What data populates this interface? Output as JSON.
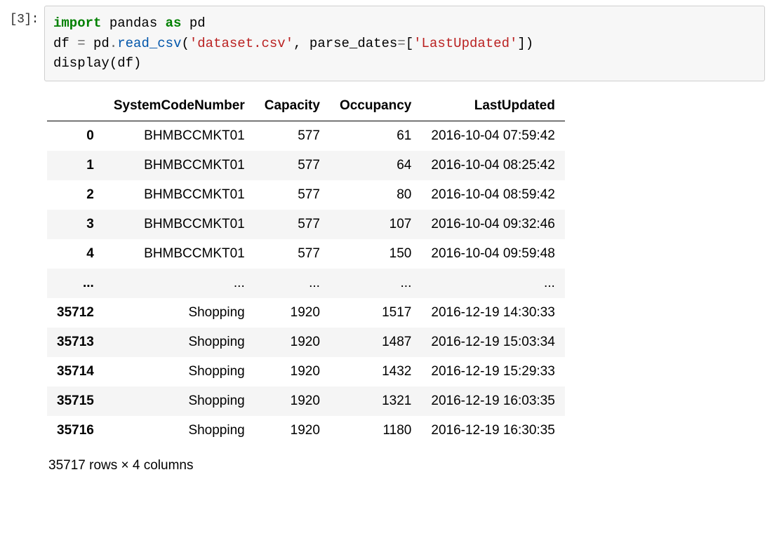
{
  "prompt": "[3]:",
  "code": {
    "kw_import": "import",
    "name_pandas": " pandas ",
    "kw_as": "as",
    "name_pd": " pd",
    "l2_a": "df ",
    "l2_op": "=",
    "l2_b": " pd",
    "l2_dot1": ".",
    "l2_call": "read_csv",
    "l2_open": "(",
    "l2_str1": "'dataset.csv'",
    "l2_comma": ", parse_dates",
    "l2_eq2": "=",
    "l2_lbr": "[",
    "l2_str2": "'LastUpdated'",
    "l2_rbr": "]",
    "l2_close": ")",
    "l3_a": "display(df)"
  },
  "table": {
    "columns": [
      "SystemCodeNumber",
      "Capacity",
      "Occupancy",
      "LastUpdated"
    ],
    "rows": [
      {
        "index": "0",
        "cells": [
          "BHMBCCMKT01",
          "577",
          "61",
          "2016-10-04 07:59:42"
        ]
      },
      {
        "index": "1",
        "cells": [
          "BHMBCCMKT01",
          "577",
          "64",
          "2016-10-04 08:25:42"
        ]
      },
      {
        "index": "2",
        "cells": [
          "BHMBCCMKT01",
          "577",
          "80",
          "2016-10-04 08:59:42"
        ]
      },
      {
        "index": "3",
        "cells": [
          "BHMBCCMKT01",
          "577",
          "107",
          "2016-10-04 09:32:46"
        ]
      },
      {
        "index": "4",
        "cells": [
          "BHMBCCMKT01",
          "577",
          "150",
          "2016-10-04 09:59:48"
        ]
      },
      {
        "index": "...",
        "cells": [
          "...",
          "...",
          "...",
          "..."
        ]
      },
      {
        "index": "35712",
        "cells": [
          "Shopping",
          "1920",
          "1517",
          "2016-12-19 14:30:33"
        ]
      },
      {
        "index": "35713",
        "cells": [
          "Shopping",
          "1920",
          "1487",
          "2016-12-19 15:03:34"
        ]
      },
      {
        "index": "35714",
        "cells": [
          "Shopping",
          "1920",
          "1432",
          "2016-12-19 15:29:33"
        ]
      },
      {
        "index": "35715",
        "cells": [
          "Shopping",
          "1920",
          "1321",
          "2016-12-19 16:03:35"
        ]
      },
      {
        "index": "35716",
        "cells": [
          "Shopping",
          "1920",
          "1180",
          "2016-12-19 16:30:35"
        ]
      }
    ],
    "caption": "35717 rows × 4 columns"
  }
}
